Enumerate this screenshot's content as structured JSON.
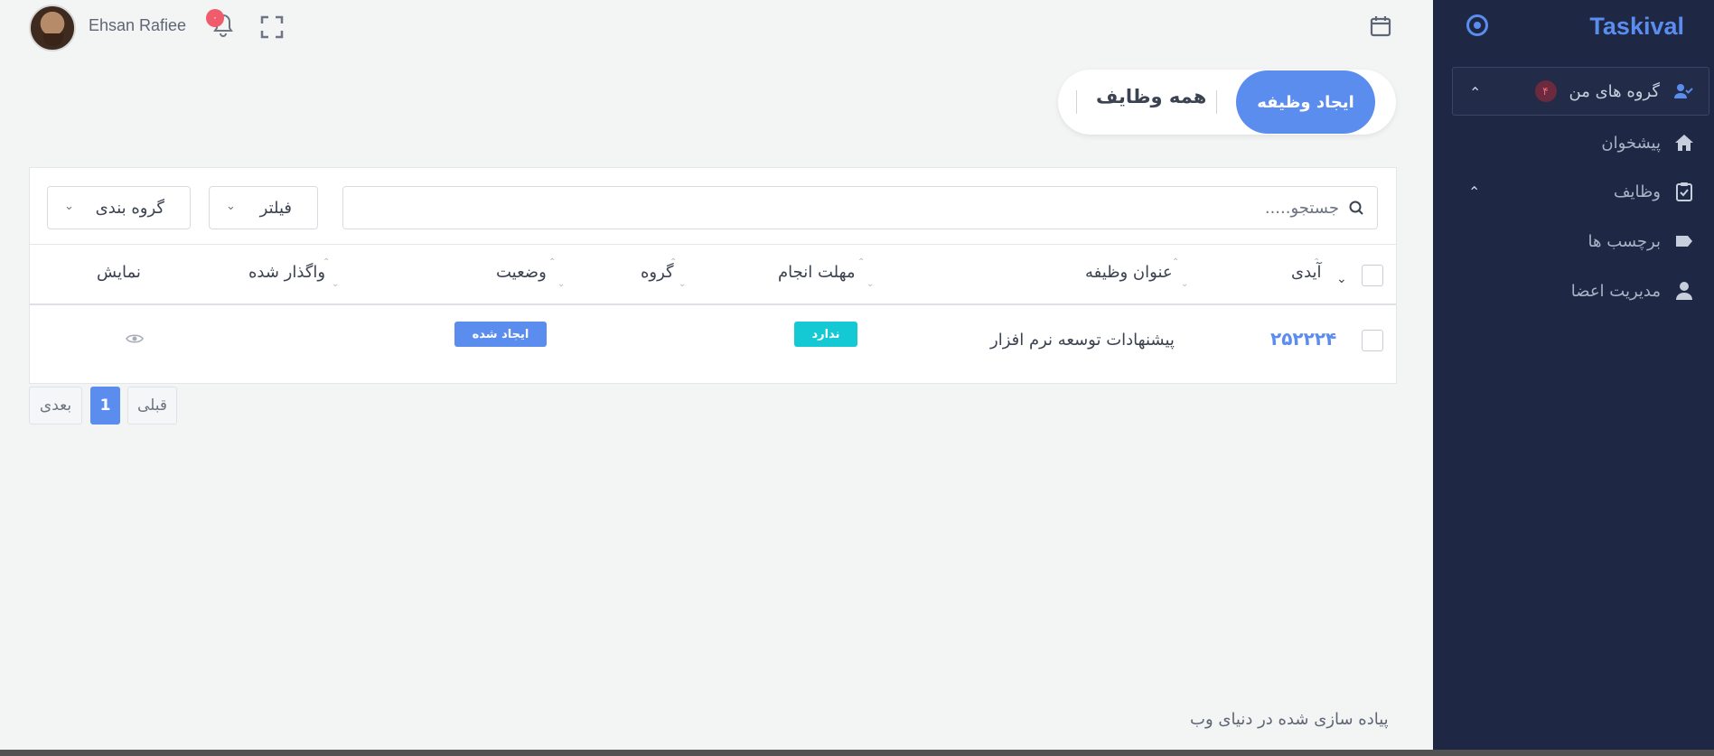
{
  "sidebar": {
    "brand": "Taskival",
    "items": [
      {
        "label": "گروه های من",
        "badge": "۴",
        "icon": "user-check-icon"
      },
      {
        "label": "پیشخوان",
        "icon": "home-icon"
      },
      {
        "label": "وظایف",
        "icon": "clipboard-check-icon"
      },
      {
        "label": "برچسب ها",
        "icon": "tag-icon"
      },
      {
        "label": "مدیریت اعضا",
        "icon": "user-icon"
      }
    ]
  },
  "topbar": {
    "username": "Ehsan Rafiee",
    "notification_count": "۰"
  },
  "tabs": {
    "create_label": "ایجاد وظیفه",
    "all_label": "همه وظایف"
  },
  "toolbar": {
    "search_placeholder": "جستجو.....",
    "filter_label": "فیلتر",
    "group_label": "گروه بندی"
  },
  "table": {
    "columns": [
      "آیدی",
      "عنوان وظیفه",
      "مهلت انجام",
      "گروه",
      "وضعیت",
      "واگذار شده",
      "نمایش"
    ],
    "rows": [
      {
        "id": "۲۵۲۲۲۴",
        "title": "پیشنهادات توسعه نرم افزار",
        "deadline": "ندارد",
        "group": "",
        "status": "ایجاد شده",
        "assignee": ""
      }
    ]
  },
  "pagination": {
    "prev": "قبلی",
    "current": "1",
    "next": "بعدی"
  },
  "footer": {
    "text": "پیاده سازی شده در  دنیای وب"
  },
  "colors": {
    "accent": "#5b8def",
    "sidebar_bg": "#1e2744",
    "deadline_badge": "#14c8d4",
    "notification": "#f15c6d"
  }
}
